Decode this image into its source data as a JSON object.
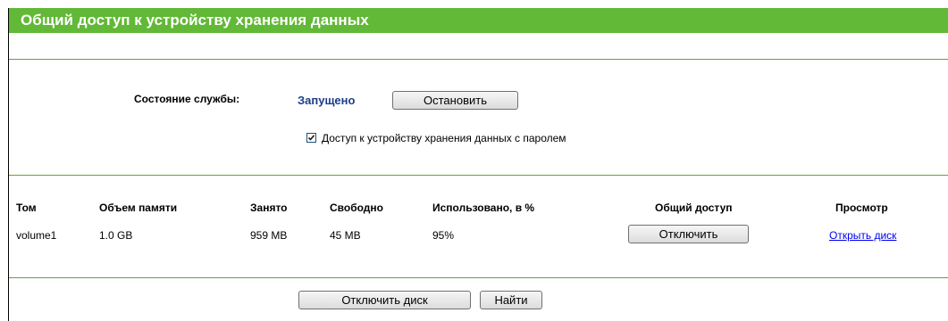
{
  "page": {
    "title": "Общий доступ к устройству хранения данных"
  },
  "service": {
    "status_label": "Состояние службы:",
    "status_value": "Запущено",
    "stop_button": "Остановить",
    "password_access_label": "Доступ к устройству хранения данных с паролем",
    "password_access_checked": true
  },
  "table": {
    "headers": {
      "volume": "Том",
      "capacity": "Объем памяти",
      "used": "Занято",
      "free": "Свободно",
      "used_percent": "Использовано, в %",
      "sharing": "Общий доступ",
      "view": "Просмотр"
    },
    "rows": [
      {
        "volume": "volume1",
        "capacity": "1.0 GB",
        "used": "959 MB",
        "free": "45 MB",
        "used_percent": "95%",
        "sharing_button": "Отключить",
        "view_link": "Открыть диск"
      }
    ]
  },
  "footer": {
    "eject_button": "Отключить диск",
    "scan_button": "Найти"
  },
  "colors": {
    "title_bar": "#62b837",
    "rule": "#5aa832",
    "status_value": "#1c3d8c",
    "link": "#0000ee"
  }
}
